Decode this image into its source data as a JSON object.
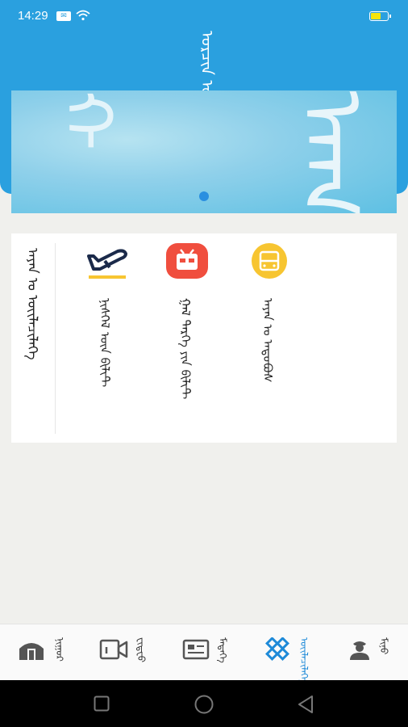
{
  "status_bar": {
    "time": "14:29",
    "sim_icon": "sim-card-icon",
    "wifi_icon": "wifi-icon",
    "battery_icon": "battery-icon",
    "battery_color": "#f4e50c"
  },
  "header": {
    "title": "ᠣᠷᠴᠢᠨ ᠤ",
    "background": "#2aa0df"
  },
  "banner": {
    "glyph_left": "ᠬ",
    "glyph_right": "ᠠᠭ"
  },
  "menu": {
    "title": "ᠠᠶᠠᠨ ᠤ ᠦᠢᠯᠡᠴᠢᠯᠡᠭᠡ",
    "items": [
      {
        "label": "ᠨᠢᠰᠬᠡᠯ ᠦᠨ ᠪᠢᠯᠢᠲ",
        "icon": "airplane-icon",
        "color": "#1b2a4a"
      },
      {
        "label": "ᠭᠠᠯ ᠲᠡᠷᠭᠡ ᠶᠢᠨ ᠪᠢᠯᠢᠲ",
        "icon": "train-icon",
        "color": "#f04e3e"
      },
      {
        "label": "ᠠᠶᠠᠨ ᠤ ᠠᠲᠤᠪᠤᠰ",
        "icon": "bus-icon",
        "color": "#f7c531"
      }
    ]
  },
  "bottom_nav": [
    {
      "label": "ᠨᠢᠭᠤᠷ",
      "icon": "yurt-icon",
      "active": false
    },
    {
      "label": "ᠸᠢᠳᠧᠣ",
      "icon": "video-icon",
      "active": false
    },
    {
      "label": "ᠮᠡᠳᠡᠭᠡ",
      "icon": "news-icon",
      "active": false
    },
    {
      "label": "ᠦᠢᠯᠡᠴᠢᠯᠡᠭᠡ",
      "icon": "knot-icon",
      "active": true
    },
    {
      "label": "ᠮᠢᠨᠤ",
      "icon": "user-icon",
      "active": false
    }
  ],
  "system_nav": {
    "icons": [
      "recent-apps-icon",
      "home-icon",
      "back-icon"
    ]
  }
}
